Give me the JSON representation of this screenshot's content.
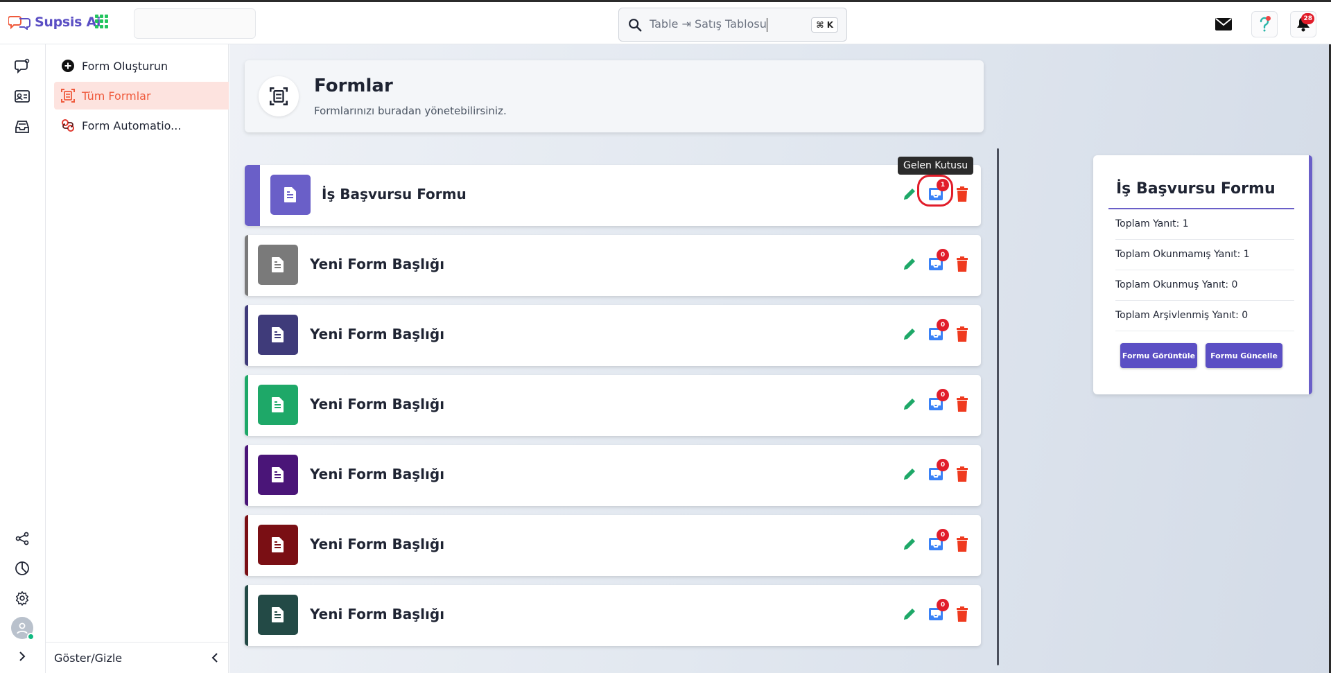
{
  "app": {
    "name": "Supsis Ai"
  },
  "search": {
    "text": "Table ⇥ Satış Tablosu",
    "shortcut": "⌘ K"
  },
  "topbar": {
    "notification_count": "28"
  },
  "sidebar": {
    "items": [
      {
        "label": "Form Oluşturun"
      },
      {
        "label": "Tüm Formlar"
      },
      {
        "label": "Form Automatio..."
      }
    ],
    "footer_label": "Göster/Gizle"
  },
  "header": {
    "title": "Formlar",
    "subtitle": "Formlarınızı buradan yönetebilirsiniz."
  },
  "tooltip": {
    "text": "Gelen Kutusu"
  },
  "forms": [
    {
      "title": "İş Başvursu Formu",
      "color": "#6a5fc8",
      "inbox_count": "1"
    },
    {
      "title": "Yeni Form Başlığı",
      "color": "#7a7a7a",
      "inbox_count": "0"
    },
    {
      "title": "Yeni Form Başlığı",
      "color": "#3f3b7a",
      "inbox_count": "0"
    },
    {
      "title": "Yeni Form Başlığı",
      "color": "#1ea868",
      "inbox_count": "0"
    },
    {
      "title": "Yeni Form Başlığı",
      "color": "#4a1578",
      "inbox_count": "0"
    },
    {
      "title": "Yeni Form Başlığı",
      "color": "#7a0f14",
      "inbox_count": "0"
    },
    {
      "title": "Yeni Form Başlığı",
      "color": "#234a46",
      "inbox_count": "0"
    }
  ],
  "stats": {
    "title": "İş Başvursu Formu",
    "rows": [
      "Toplam Yanıt: 1",
      "Toplam Okunmamış Yanıt: 1",
      "Toplam Okunmuş Yanıt: 0",
      "Toplam Arşivlenmiş Yanıt: 0"
    ],
    "view_button": "Formu Görüntüle",
    "update_button": "Formu Güncelle"
  },
  "colors": {
    "brand": "#5b4fc4",
    "active_item": "#ef5a3c",
    "edit": "#1ea868",
    "inbox": "#3b82f6",
    "delete": "#ef3a1f",
    "badge": "#e11d2a"
  }
}
